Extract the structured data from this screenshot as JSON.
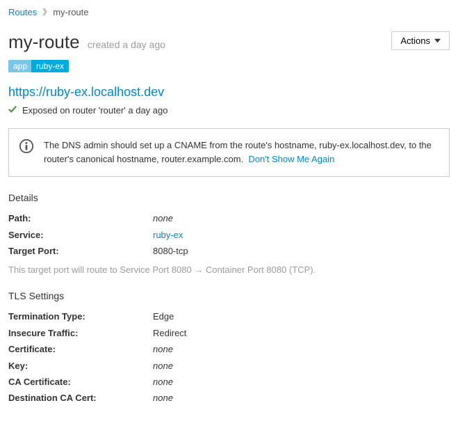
{
  "breadcrumb": {
    "parent": "Routes",
    "current": "my-route"
  },
  "header": {
    "title": "my-route",
    "created": "created a day ago",
    "actions_label": "Actions"
  },
  "tags": {
    "key": "app",
    "value": "ruby-ex"
  },
  "route": {
    "url": "https://ruby-ex.localhost.dev",
    "status": "Exposed on router 'router' a day ago"
  },
  "info": {
    "message": "The DNS admin should set up a CNAME from the route's hostname, ruby-ex.localhost.dev, to the router's canonical hostname, router.example.com.",
    "dismiss": "Don't Show Me Again"
  },
  "details": {
    "section_title": "Details",
    "rows": [
      {
        "label": "Path:",
        "value": "none",
        "is_none": true
      },
      {
        "label": "Service:",
        "value": "ruby-ex",
        "is_link": true
      },
      {
        "label": "Target Port:",
        "value": "8080-tcp"
      }
    ],
    "port_note": "This target port will route to Service Port 8080 → Container Port 8080 (TCP)."
  },
  "tls": {
    "section_title": "TLS Settings",
    "rows": [
      {
        "label": "Termination Type:",
        "value": "Edge"
      },
      {
        "label": "Insecure Traffic:",
        "value": "Redirect"
      },
      {
        "label": "Certificate:",
        "value": "none",
        "is_none": true
      },
      {
        "label": "Key:",
        "value": "none",
        "is_none": true
      },
      {
        "label": "CA Certificate:",
        "value": "none",
        "is_none": true
      },
      {
        "label": "Destination CA Cert:",
        "value": "none",
        "is_none": true
      }
    ]
  }
}
